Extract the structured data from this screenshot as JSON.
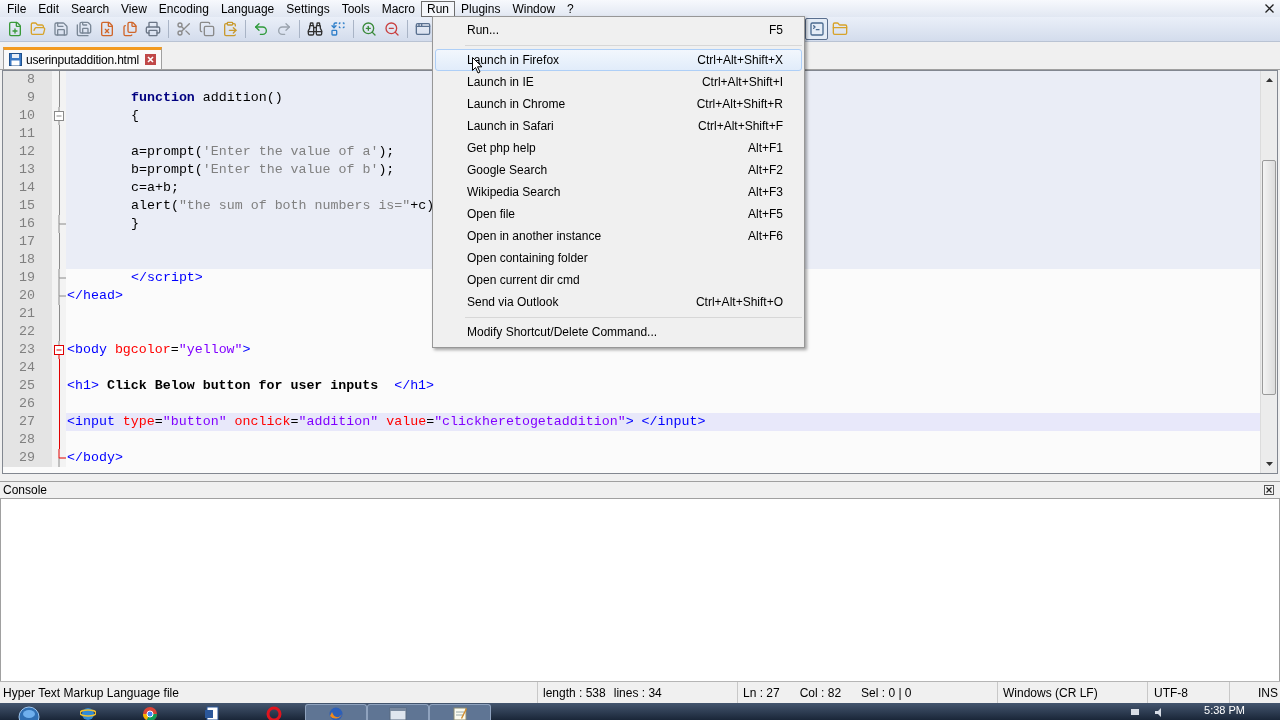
{
  "menu_bar": {
    "items": [
      {
        "label": "File",
        "selected": false
      },
      {
        "label": "Edit",
        "selected": false
      },
      {
        "label": "Search",
        "selected": false
      },
      {
        "label": "View",
        "selected": false
      },
      {
        "label": "Encoding",
        "selected": false
      },
      {
        "label": "Language",
        "selected": false
      },
      {
        "label": "Settings",
        "selected": false
      },
      {
        "label": "Tools",
        "selected": false
      },
      {
        "label": "Macro",
        "selected": false
      },
      {
        "label": "Run",
        "selected": true
      },
      {
        "label": "Plugins",
        "selected": false
      },
      {
        "label": "Window",
        "selected": false
      },
      {
        "label": "?",
        "selected": false
      }
    ]
  },
  "toolbar": {
    "console_pressed": true
  },
  "tabs": [
    {
      "label": "userinputaddition.html",
      "selected": true
    }
  ],
  "editor": {
    "lines": [
      {
        "number": "8",
        "script_block": true,
        "current": false
      },
      {
        "number": "9",
        "script_block": true,
        "current": false,
        "indented": true,
        "segments": [
          {
            "text": "function",
            "kind": "keyword"
          },
          {
            "text": " addition()",
            "kind": "plain"
          }
        ]
      },
      {
        "number": "10",
        "script_block": true,
        "current": false,
        "indented": true,
        "segments": [
          {
            "text": "{",
            "kind": "plain"
          }
        ],
        "fold": {
          "kind": "start",
          "active": false
        }
      },
      {
        "number": "11",
        "script_block": true,
        "current": false
      },
      {
        "number": "12",
        "script_block": true,
        "current": false,
        "indented": true,
        "segments": [
          {
            "text": "a=prompt(",
            "kind": "plain"
          },
          {
            "text": "'Enter the value of a'",
            "kind": "string"
          },
          {
            "text": ");",
            "kind": "plain"
          }
        ]
      },
      {
        "number": "13",
        "script_block": true,
        "current": false,
        "indented": true,
        "segments": [
          {
            "text": "b=prompt(",
            "kind": "plain"
          },
          {
            "text": "'Enter the value of b'",
            "kind": "string"
          },
          {
            "text": ");",
            "kind": "plain"
          }
        ]
      },
      {
        "number": "14",
        "script_block": true,
        "current": false,
        "indented": true,
        "segments": [
          {
            "text": "c=a+b;",
            "kind": "plain"
          }
        ]
      },
      {
        "number": "15",
        "script_block": true,
        "current": false,
        "indented": true,
        "segments": [
          {
            "text": "alert(",
            "kind": "plain"
          },
          {
            "text": "\"the sum of both numbers is=\"",
            "kind": "string"
          },
          {
            "text": "+c)",
            "kind": "plain"
          }
        ]
      },
      {
        "number": "16",
        "script_block": true,
        "current": false,
        "indented": true,
        "segments": [
          {
            "text": "}",
            "kind": "plain"
          }
        ],
        "fold": {
          "kind": "end",
          "active": false
        }
      },
      {
        "number": "17",
        "script_block": true,
        "current": false
      },
      {
        "number": "18",
        "script_block": true,
        "current": false
      },
      {
        "number": "19",
        "script_block": false,
        "current": false,
        "indented": true,
        "segments": [
          {
            "text": "</script>",
            "kind": "tag"
          }
        ],
        "fold": {
          "kind": "end",
          "active": false
        }
      },
      {
        "number": "20",
        "script_block": false,
        "current": false,
        "indented": false,
        "segments": [
          {
            "text": "</head>",
            "kind": "tag"
          }
        ],
        "fold": {
          "kind": "end",
          "active": false
        }
      },
      {
        "number": "21",
        "script_block": false,
        "current": false
      },
      {
        "number": "22",
        "script_block": false,
        "current": false
      },
      {
        "number": "23",
        "script_block": false,
        "current": false,
        "indented": false,
        "segments": [
          {
            "text": "<body",
            "kind": "tag"
          },
          {
            "text": " bgcolor",
            "kind": "attr"
          },
          {
            "text": "=",
            "kind": "plain"
          },
          {
            "text": "\"yellow\"",
            "kind": "value"
          },
          {
            "text": ">",
            "kind": "tag"
          }
        ],
        "fold": {
          "kind": "start",
          "active": true
        }
      },
      {
        "number": "24",
        "script_block": false,
        "current": false
      },
      {
        "number": "25",
        "script_block": false,
        "current": false,
        "indented": false,
        "segments": [
          {
            "text": "<h1>",
            "kind": "tag"
          },
          {
            "text": " Click Below button for user inputs  ",
            "kind": "text"
          },
          {
            "text": "</h1>",
            "kind": "tag"
          }
        ]
      },
      {
        "number": "26",
        "script_block": false,
        "current": false
      },
      {
        "number": "27",
        "script_block": false,
        "current": true,
        "indented": false,
        "segments": [
          {
            "text": "<input",
            "kind": "tag"
          },
          {
            "text": " type",
            "kind": "attr"
          },
          {
            "text": "=",
            "kind": "plain"
          },
          {
            "text": "\"button\"",
            "kind": "value"
          },
          {
            "text": " onclick",
            "kind": "attr"
          },
          {
            "text": "=",
            "kind": "plain"
          },
          {
            "text": "\"addition\"",
            "kind": "value"
          },
          {
            "text": " value",
            "kind": "attr"
          },
          {
            "text": "=",
            "kind": "plain"
          },
          {
            "text": "\"clickheretogetaddition\"",
            "kind": "value"
          },
          {
            "text": ">",
            "kind": "tag"
          },
          {
            "text": " </input>",
            "kind": "tag"
          }
        ]
      },
      {
        "number": "28",
        "script_block": false,
        "current": false
      },
      {
        "number": "29",
        "script_block": false,
        "current": false,
        "indented": false,
        "segments": [
          {
            "text": "</body>",
            "kind": "tag"
          }
        ],
        "fold": {
          "kind": "end",
          "active": true
        }
      }
    ]
  },
  "run_menu": {
    "groups": [
      [
        {
          "label": "Run...",
          "shortcut": "F5",
          "highlighted": false
        }
      ],
      [
        {
          "label": "Launch in Firefox",
          "shortcut": "Ctrl+Alt+Shift+X",
          "highlighted": true
        },
        {
          "label": "Launch in IE",
          "shortcut": "Ctrl+Alt+Shift+I",
          "highlighted": false
        },
        {
          "label": "Launch in Chrome",
          "shortcut": "Ctrl+Alt+Shift+R",
          "highlighted": false
        },
        {
          "label": "Launch in Safari",
          "shortcut": "Ctrl+Alt+Shift+F",
          "highlighted": false
        },
        {
          "label": "Get php help",
          "shortcut": "Alt+F1",
          "highlighted": false
        },
        {
          "label": "Google Search",
          "shortcut": "Alt+F2",
          "highlighted": false
        },
        {
          "label": "Wikipedia Search",
          "shortcut": "Alt+F3",
          "highlighted": false
        },
        {
          "label": "Open file",
          "shortcut": "Alt+F5",
          "highlighted": false
        },
        {
          "label": "Open in another instance",
          "shortcut": "Alt+F6",
          "highlighted": false
        },
        {
          "label": "Open containing folder",
          "highlighted": false
        },
        {
          "label": "Open current dir cmd",
          "highlighted": false
        },
        {
          "label": "Send via Outlook",
          "shortcut": "Ctrl+Alt+Shift+O",
          "highlighted": false
        }
      ],
      [
        {
          "label": "Modify Shortcut/Delete Command...",
          "highlighted": false
        }
      ]
    ]
  },
  "console": {
    "title": "Console"
  },
  "status_bar": {
    "file_type": "Hyper Text Markup Language file",
    "length": "length : 538",
    "lines": "lines : 34",
    "line": "Ln : 27",
    "column": "Col : 82",
    "selection": "Sel : 0 | 0",
    "line_endings": "Windows (CR LF)",
    "encoding": "UTF-8",
    "mode": "INS"
  },
  "taskbar": {
    "buttons": [
      {
        "open": false
      },
      {
        "open": false
      },
      {
        "open": false
      },
      {
        "open": false
      },
      {
        "open": false
      },
      {
        "open": true
      },
      {
        "open": true
      },
      {
        "open": true
      }
    ],
    "clock": "5:38 PM"
  }
}
